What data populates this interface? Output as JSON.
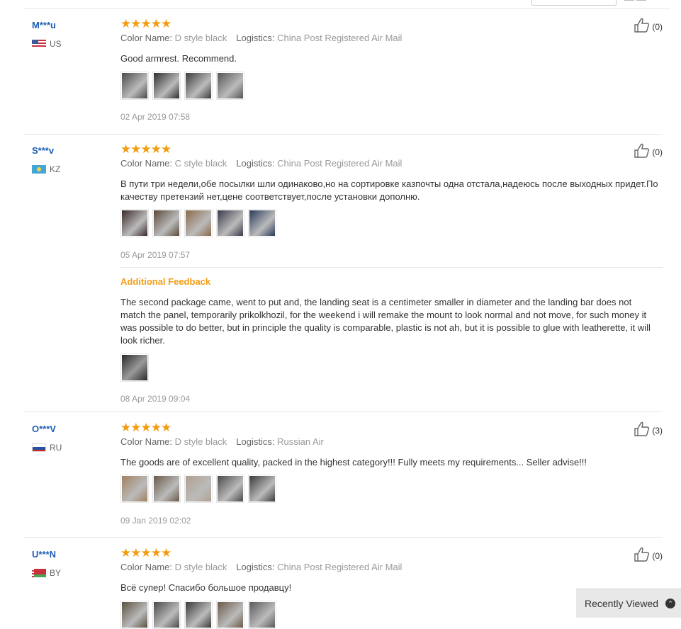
{
  "reviews": [
    {
      "user": "M***u",
      "country": "US",
      "flag": "us",
      "stars": "★★★★★",
      "color_name_label": "Color Name:",
      "color_name": "D style black",
      "logistics_label": "Logistics:",
      "logistics": "China Post Registered Air Mail",
      "text": "Good armrest. Recommend.",
      "photos": [
        "#4a4a4a",
        "#2e2e2e",
        "#3c3c3c",
        "#555555"
      ],
      "date": "02 Apr 2019 07:58",
      "helpful": "(0)"
    },
    {
      "user": "S***v",
      "country": "KZ",
      "flag": "kz",
      "stars": "★★★★★",
      "color_name_label": "Color Name:",
      "color_name": "C style black",
      "logistics_label": "Logistics:",
      "logistics": "China Post Registered Air Mail",
      "text": "В пути три недели,обе посылки шли одинаково,но на сортировке казпочты одна отстала,надеюсь после выходных придет.По качеству претензий нет,цене соответствует,после установки дополню.",
      "photos": [
        "#3a2a2a",
        "#5a4a3a",
        "#8a6a4a",
        "#3a3a4a",
        "#2a3a5a"
      ],
      "date": "05 Apr 2019 07:57",
      "helpful": "(0)",
      "additional_feedback_label": "Additional Feedback",
      "additional_text": "The second package came, went to put and, the landing seat is a centimeter smaller in diameter and the landing bar does not match the panel, temporarily prikolkhozil, for the weekend i will remake the mount to look normal and not move, for such money it was possible to do better, but in principle the quality is comparable, plastic is not ah, but it is possible to glue with leatherette, it will look richer.",
      "additional_photos": [
        "#2a2a2a"
      ],
      "additional_date": "08 Apr 2019 09:04"
    },
    {
      "user": "O***V",
      "country": "RU",
      "flag": "ru",
      "stars": "★★★★★",
      "color_name_label": "Color Name:",
      "color_name": "D style black",
      "logistics_label": "Logistics:",
      "logistics": "Russian Air",
      "text": "The goods are of excellent quality, packed in the highest category!!! Fully meets my requirements... Seller advise!!!",
      "photos": [
        "#a08060",
        "#6a5a4a",
        "#b0a090",
        "#4a4a4a",
        "#3a3a3a"
      ],
      "date": "09 Jan 2019 02:02",
      "helpful": "(3)"
    },
    {
      "user": "U***N",
      "country": "BY",
      "flag": "by",
      "stars": "★★★★★",
      "color_name_label": "Color Name:",
      "color_name": "D style black",
      "logistics_label": "Logistics:",
      "logistics": "China Post Registered Air Mail",
      "text": "Всё супер! Спасибо большое продавцу!",
      "photos": [
        "#5a5040",
        "#4a4a4a",
        "#3a3a3a",
        "#6a5a4a",
        "#5a5a5a"
      ],
      "helpful": "(0)"
    }
  ],
  "recently_viewed": "Recently Viewed",
  "colors": {
    "username": "#1e5fb4",
    "stars": "#f39c12",
    "muted": "#999999"
  }
}
